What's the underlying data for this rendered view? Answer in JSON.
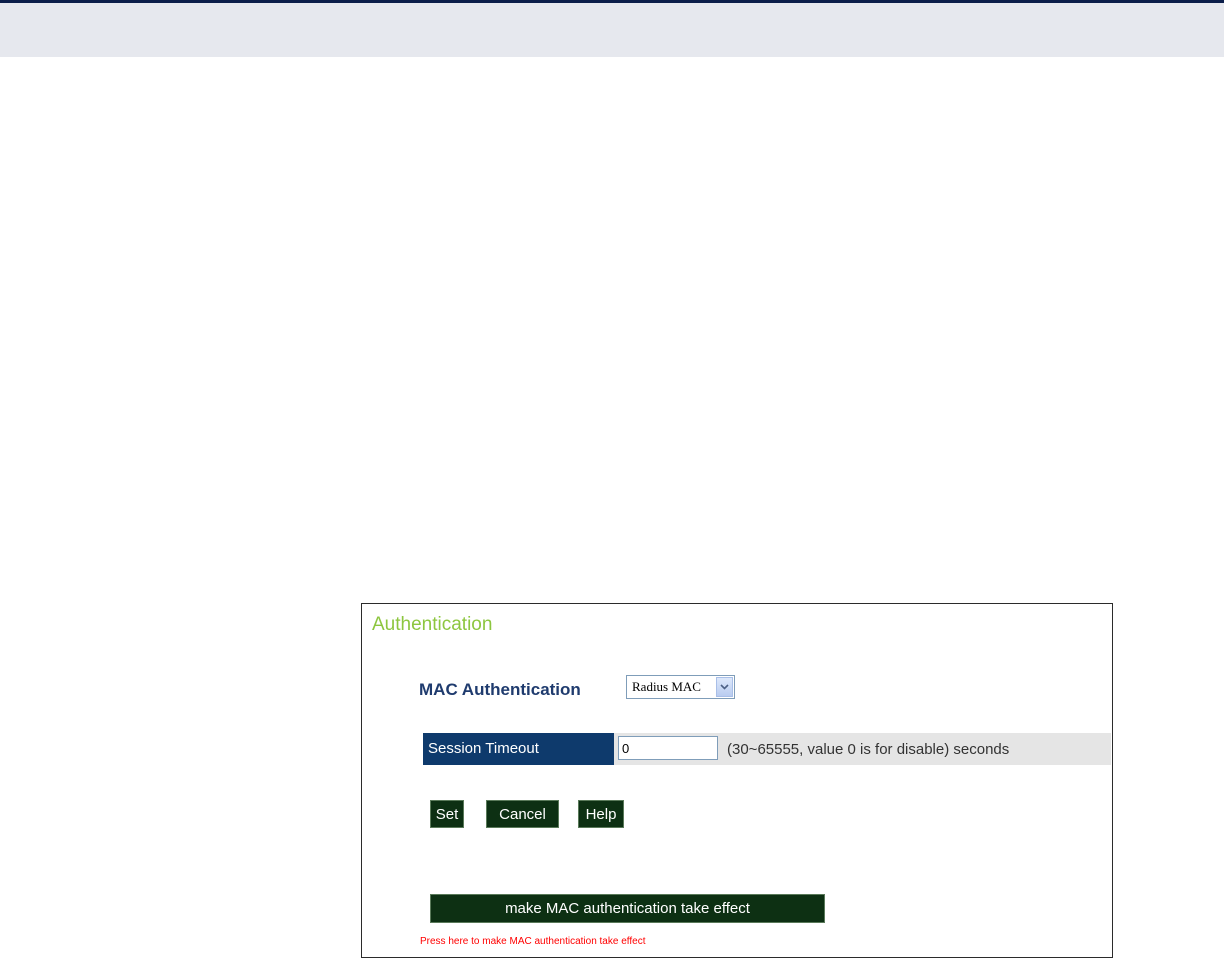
{
  "panel": {
    "title": "Authentication",
    "mac_auth": {
      "label": "MAC Authentication",
      "selected": "Radius MAC"
    },
    "session_timeout": {
      "label": "Session Timeout",
      "value": "0",
      "hint": "(30~65555, value 0 is for disable) seconds"
    },
    "buttons": {
      "set": "Set",
      "cancel": "Cancel",
      "help": "Help"
    },
    "effect": {
      "button_label": "make MAC authentication take effect",
      "note": "Press here to make MAC authentication take effect"
    }
  }
}
